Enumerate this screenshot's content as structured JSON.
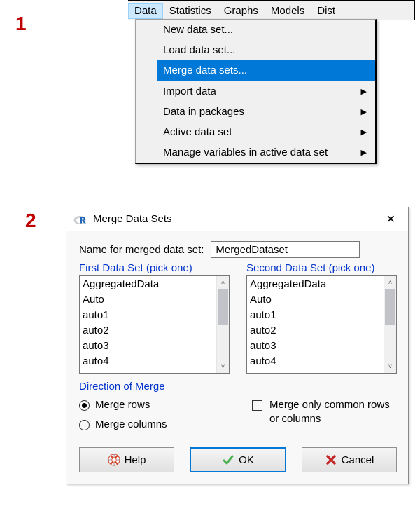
{
  "annotations": {
    "one": "1",
    "two": "2"
  },
  "menubar": {
    "items": [
      "Data",
      "Statistics",
      "Graphs",
      "Models",
      "Dist"
    ],
    "selected_index": 0
  },
  "dropdown": {
    "items": [
      {
        "label": "New data set...",
        "has_submenu": false,
        "highlighted": false
      },
      {
        "label": "Load data set...",
        "has_submenu": false,
        "highlighted": false
      },
      {
        "label": "Merge data sets...",
        "has_submenu": false,
        "highlighted": true
      },
      {
        "sep": true
      },
      {
        "label": "Import data",
        "has_submenu": true,
        "highlighted": false
      },
      {
        "label": "Data in packages",
        "has_submenu": true,
        "highlighted": false
      },
      {
        "label": "Active data set",
        "has_submenu": true,
        "highlighted": false
      },
      {
        "label": "Manage variables in active data set",
        "has_submenu": true,
        "highlighted": false
      }
    ]
  },
  "dialog": {
    "title": "Merge Data Sets",
    "name_label": "Name for merged data set:",
    "name_value": "MergedDataset",
    "first_set_label": "First Data Set (pick one)",
    "second_set_label": "Second Data Set (pick one)",
    "datasets": [
      "AggregatedData",
      "Auto",
      "auto1",
      "auto2",
      "auto3",
      "auto4"
    ],
    "direction_label": "Direction of Merge",
    "radio": {
      "rows_label": "Merge rows",
      "cols_label": "Merge columns",
      "selected": "rows"
    },
    "common_check": {
      "label": "Merge only common rows or columns",
      "checked": false
    },
    "buttons": {
      "help": "Help",
      "ok": "OK",
      "cancel": "Cancel"
    }
  }
}
